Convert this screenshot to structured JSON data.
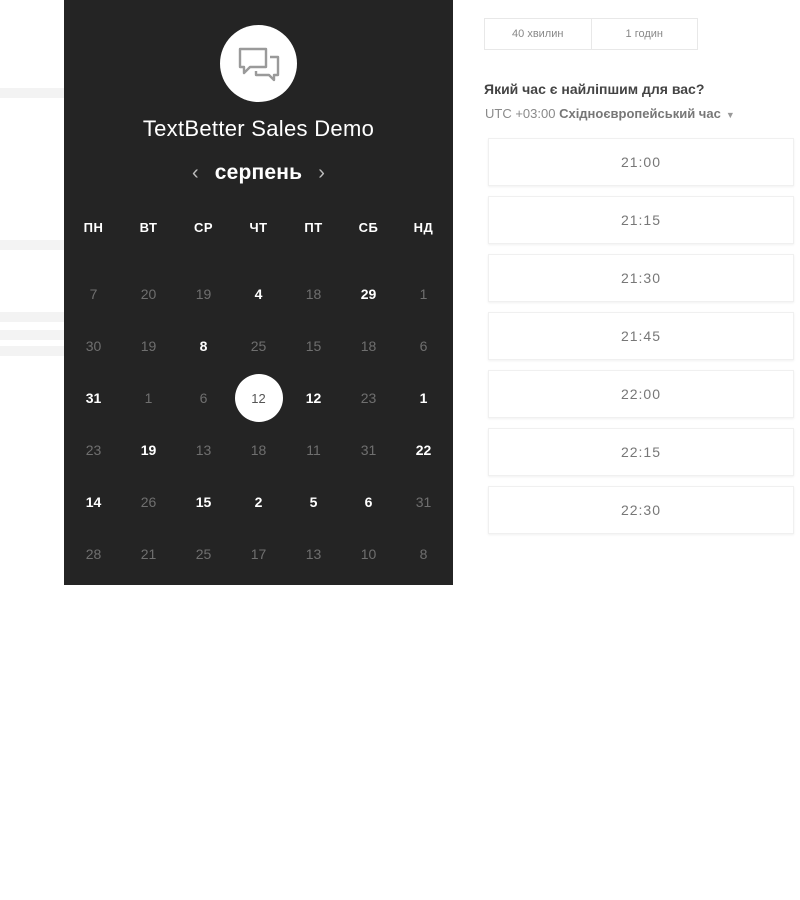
{
  "event": {
    "title": "TextBetter Sales Demo"
  },
  "calendar": {
    "month": "серпень",
    "weekdays": [
      "ПН",
      "ВТ",
      "СР",
      "ЧТ",
      "ПТ",
      "СБ",
      "НД"
    ],
    "weeks": [
      [
        {
          "d": "7",
          "a": false
        },
        {
          "d": "20",
          "a": false
        },
        {
          "d": "19",
          "a": false
        },
        {
          "d": "4",
          "a": true
        },
        {
          "d": "18",
          "a": false
        },
        {
          "d": "29",
          "a": true
        },
        {
          "d": "1",
          "a": false
        }
      ],
      [
        {
          "d": "30",
          "a": false
        },
        {
          "d": "19",
          "a": false
        },
        {
          "d": "8",
          "a": true
        },
        {
          "d": "25",
          "a": false
        },
        {
          "d": "15",
          "a": false
        },
        {
          "d": "18",
          "a": false
        },
        {
          "d": "6",
          "a": false
        }
      ],
      [
        {
          "d": "31",
          "a": true
        },
        {
          "d": "1",
          "a": false
        },
        {
          "d": "6",
          "a": false
        },
        {
          "d": "12",
          "a": true,
          "selected": true
        },
        {
          "d": "12",
          "a": true
        },
        {
          "d": "23",
          "a": false
        },
        {
          "d": "1",
          "a": true
        }
      ],
      [
        {
          "d": "23",
          "a": false
        },
        {
          "d": "19",
          "a": true
        },
        {
          "d": "13",
          "a": false
        },
        {
          "d": "18",
          "a": false
        },
        {
          "d": "11",
          "a": false
        },
        {
          "d": "31",
          "a": false
        },
        {
          "d": "22",
          "a": true
        }
      ],
      [
        {
          "d": "14",
          "a": true
        },
        {
          "d": "26",
          "a": false
        },
        {
          "d": "15",
          "a": true
        },
        {
          "d": "2",
          "a": true
        },
        {
          "d": "5",
          "a": true
        },
        {
          "d": "6",
          "a": true
        },
        {
          "d": "31",
          "a": false
        }
      ],
      [
        {
          "d": "28",
          "a": false
        },
        {
          "d": "21",
          "a": false
        },
        {
          "d": "25",
          "a": false
        },
        {
          "d": "17",
          "a": false
        },
        {
          "d": "13",
          "a": false
        },
        {
          "d": "10",
          "a": false
        },
        {
          "d": "8",
          "a": false
        }
      ]
    ]
  },
  "duration": {
    "options": [
      "40 хвилин",
      "1 годин"
    ]
  },
  "schedule": {
    "question": "Який час є найліпшим для вас?",
    "tz_offset": "UTC +03:00",
    "tz_name": "Східноєвропейський час",
    "slots": [
      "21:00",
      "21:15",
      "21:30",
      "21:45",
      "22:00",
      "22:15",
      "22:30"
    ]
  },
  "colors": {
    "panel": "#242424",
    "text_available": "#ffffff",
    "text_unavailable": "#6f6f6f"
  },
  "icons": {
    "logo": "chat-bubbles-icon",
    "prev": "chevron-left-icon",
    "next": "chevron-right-icon",
    "tz": "caret-down-icon"
  }
}
